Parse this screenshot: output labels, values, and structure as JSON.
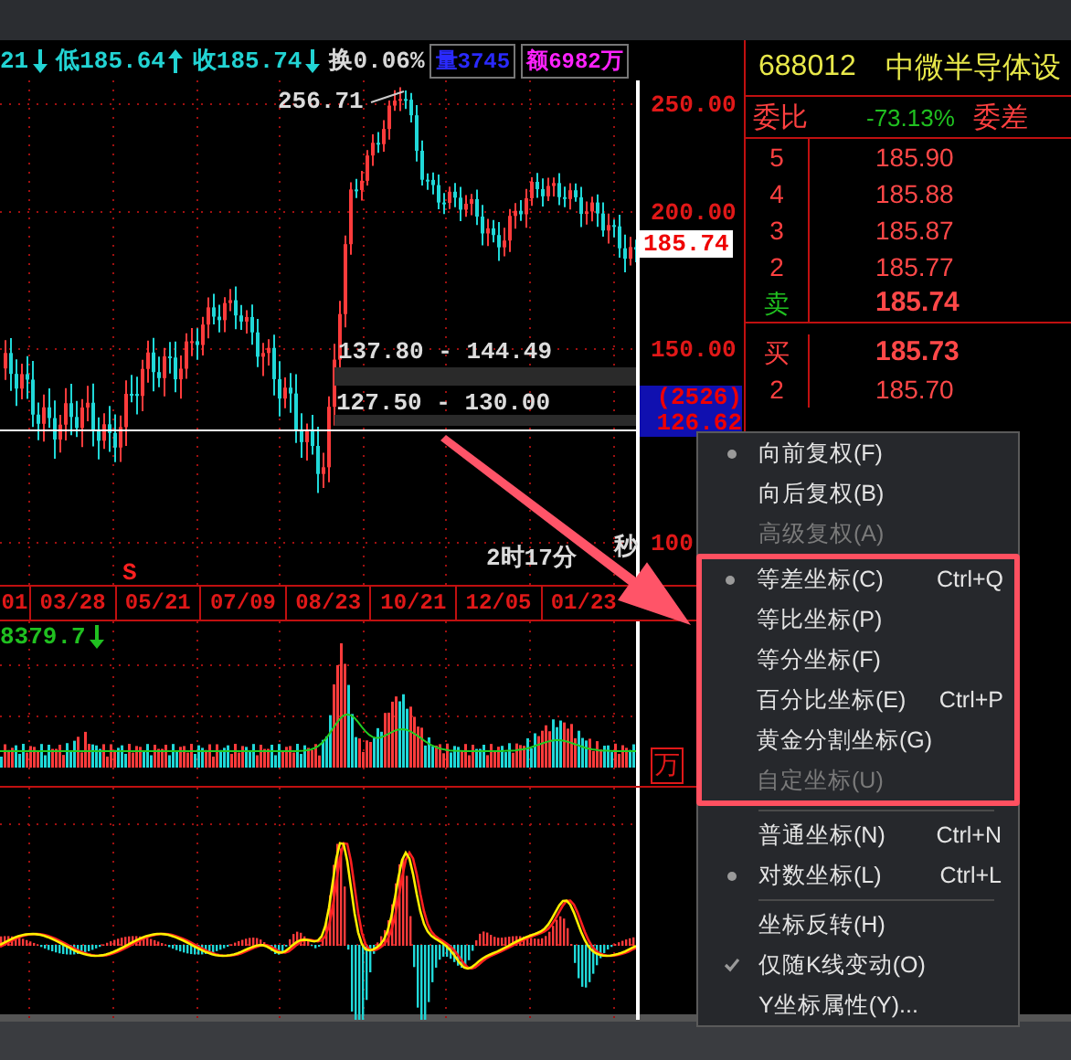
{
  "header": {
    "items": [
      {
        "text": "21",
        "kind": "falling",
        "color": "#22d3d3"
      },
      {
        "text": "低185.64",
        "kind": "rising",
        "color": "#22d3d3"
      },
      {
        "text": "收185.74",
        "kind": "falling",
        "color": "#22d3d3"
      },
      {
        "text": "换0.06%",
        "kind": "plain",
        "color": "#d8d8d8"
      }
    ],
    "tags": [
      {
        "text": "量3745",
        "color": "#2a2aff"
      },
      {
        "text": "额6982万",
        "color": "#ff22ff"
      }
    ]
  },
  "price_chart": {
    "high_label": "256.71",
    "ranges": [
      "137.80 - 144.49",
      "127.50 - 130.00"
    ],
    "countdown": "2时17分",
    "countdown_end": "秒",
    "signal": "S",
    "y_ticks": [
      "250.00",
      "200.00",
      "150.00",
      "100"
    ],
    "last_price": "185.74",
    "cursor_count": "(2526)",
    "cursor_price": "126.62"
  },
  "dates": [
    "01",
    "03/28",
    "05/21",
    "07/09",
    "08/23",
    "10/21",
    "12/05",
    "01/23"
  ],
  "volume": {
    "value": "8379.7",
    "kind": "falling",
    "unit": "万"
  },
  "quote": {
    "code": "688012",
    "name": "中微半导体设",
    "ratio_label": "委比",
    "ratio": "-73.13%",
    "diff_label": "委差",
    "asks": [
      {
        "level": "5",
        "price": "185.90"
      },
      {
        "level": "4",
        "price": "185.88"
      },
      {
        "level": "3",
        "price": "185.87"
      },
      {
        "level": "2",
        "price": "185.77"
      },
      {
        "level": "卖",
        "price": "185.74"
      }
    ],
    "bids": [
      {
        "level": "买",
        "price": "185.73"
      },
      {
        "level": "2",
        "price": "185.70"
      }
    ]
  },
  "menu": {
    "groups": [
      {
        "highlighted": false,
        "items": [
          {
            "label": "向前复权(F)",
            "selected": true,
            "disabled": false
          },
          {
            "label": "向后复权(B)",
            "selected": false,
            "disabled": false
          },
          {
            "label": "高级复权(A)",
            "selected": false,
            "disabled": true
          }
        ]
      },
      {
        "highlighted": true,
        "items": [
          {
            "label": "等差坐标(C)",
            "shortcut": "Ctrl+Q",
            "selected": true,
            "disabled": false
          },
          {
            "label": "等比坐标(P)",
            "selected": false,
            "disabled": false
          },
          {
            "label": "等分坐标(F)",
            "selected": false,
            "disabled": false
          },
          {
            "label": "百分比坐标(E)",
            "shortcut": "Ctrl+P",
            "selected": false,
            "disabled": false
          },
          {
            "label": "黄金分割坐标(G)",
            "selected": false,
            "disabled": false
          },
          {
            "label": "自定坐标(U)",
            "selected": false,
            "disabled": true
          }
        ]
      },
      {
        "highlighted": false,
        "items": [
          {
            "label": "普通坐标(N)",
            "shortcut": "Ctrl+N",
            "selected": false,
            "disabled": false
          },
          {
            "label": "对数坐标(L)",
            "shortcut": "Ctrl+L",
            "selected": true,
            "disabled": false
          }
        ]
      },
      {
        "highlighted": false,
        "items": [
          {
            "label": "坐标反转(H)",
            "checked": false,
            "disabled": false
          },
          {
            "label": "仅随K线变动(O)",
            "checked": true,
            "disabled": false
          },
          {
            "label": "Y坐标属性(Y)...",
            "checked": false,
            "disabled": false
          }
        ]
      }
    ]
  }
}
